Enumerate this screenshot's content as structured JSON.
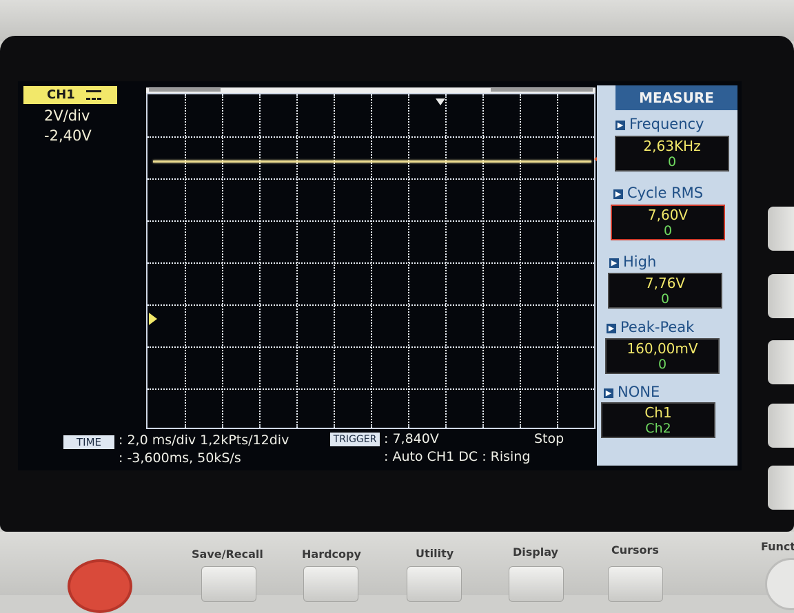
{
  "channel": {
    "name": "CH1",
    "volts_per_div": "2V/div",
    "offset": "-2,40V"
  },
  "timebase": {
    "label": "TIME",
    "line1": ": 2,0 ms/div 1,2kPts/12div",
    "line2": ": -3,600ms, 50kS/s"
  },
  "trigger": {
    "label": "TRIGGER",
    "level": ": 7,840V",
    "status": "Stop",
    "mode": ": Auto CH1 DC : Rising"
  },
  "measure": {
    "title": "MEASURE",
    "items": [
      {
        "label": "Frequency",
        "value": "2,63KHz",
        "sub": "0"
      },
      {
        "label": "Cycle RMS",
        "value": "7,60V",
        "sub": "0"
      },
      {
        "label": "High",
        "value": "7,76V",
        "sub": "0"
      },
      {
        "label": "Peak-Peak",
        "value": "160,00mV",
        "sub": "0"
      },
      {
        "label": "NONE",
        "value": "Ch1",
        "sub": "Ch2"
      }
    ]
  },
  "front_panel": {
    "buttons": [
      "Save/Recall",
      "Hardcopy",
      "Utility",
      "Display",
      "Cursors"
    ],
    "partial_label": "Funct"
  },
  "colors": {
    "trace": "#ecdc90",
    "channel_badge": "#f2e86a",
    "measure_header": "#2f5f95",
    "active_border": "#d03a2a"
  },
  "icons": {
    "dc_coupling": "dc-coupling-icon",
    "trigger_position": "trigger-position-icon",
    "trigger_level": "trigger-level-icon",
    "channel_reference": "channel-reference-icon",
    "power": "power-icon"
  }
}
